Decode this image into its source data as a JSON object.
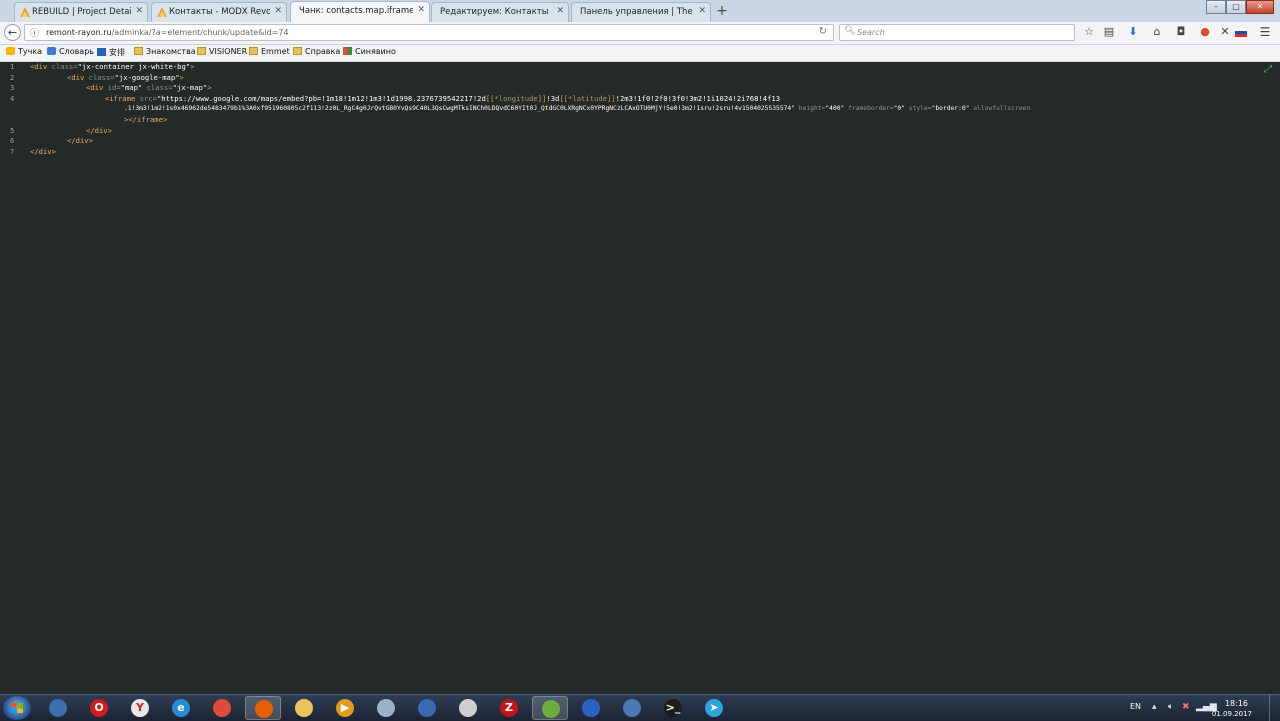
{
  "browser": {
    "tabs": [
      {
        "title": "REBUILD | Project Details",
        "icon": "modx-icon"
      },
      {
        "title": "Контакты - MODX Revolution",
        "icon": "modx-icon"
      },
      {
        "title": "Чанк: contacts.map.iframe | MOD",
        "icon": "none",
        "active": true
      },
      {
        "title": "Редактируем: Контакты | MODX",
        "icon": "none"
      },
      {
        "title": "Панель управления | The Pisicks",
        "icon": "none"
      }
    ],
    "new_tab_symbol": "+",
    "window_controls": {
      "minimize": "–",
      "maximize": "□",
      "close": "✕"
    },
    "url": {
      "host": "remont-rayon.ru",
      "path": "/adminka/?a=element/chunk/update&id=74"
    },
    "search_placeholder": "Search",
    "bookmarks": [
      {
        "label": "Тучка",
        "icon": "cloud-icon"
      },
      {
        "label": "Словарь",
        "icon": "dictionary-icon"
      },
      {
        "label": "安排",
        "icon": "calendar-icon"
      },
      {
        "label": "Знакомства",
        "icon": "folder-icon"
      },
      {
        "label": "VISIONER",
        "icon": "folder-icon"
      },
      {
        "label": "Emmet",
        "icon": "folder-icon"
      },
      {
        "label": "Справка",
        "icon": "folder-icon"
      },
      {
        "label": "Синявино",
        "icon": "grid-icon"
      }
    ]
  },
  "editor": {
    "line_numbers": [
      "1",
      "2",
      "3",
      "4",
      "5",
      "6",
      "7"
    ],
    "l1": {
      "open": "<div",
      "attr": " class=",
      "val": "\"jx-container jx-white-bg\"",
      "close": ">"
    },
    "l2": {
      "open": "<div",
      "attr": " class=",
      "val": "\"jx-google-map\"",
      "close": ">"
    },
    "l3": {
      "open": "<div",
      "attr1": " id=",
      "val1": "\"map\"",
      "attr2": " class=",
      "val2": "\"jx-map\"",
      "close": ">"
    },
    "l4a": {
      "open": "<iframe",
      "attr": " src=",
      "v1": "\"https://www.google.com/maps/embed?pb=!1m18!1m12!1m3!1d1998.2376739542217!2d",
      "b1": "[[",
      "p1": "*longitude",
      "b2": "]]",
      "v2": "!3d",
      "b3": "[[",
      "p2": "*latitude",
      "b4": "]]",
      "v3": "!2m3!1f0!2f0!3f0!3m2!1i1024!2i768!4f13"
    },
    "l4b": {
      "v": ".1!3m3!1m2!1s0x46962de5483479b1%3A0xf951960805c2f113!2z0L_RgC4g0JrQvtGB0YvQs9C40L3QsCwgMTksINCh0LDQvdC60YIt0J_QtdGC0LXRgNCx0YPRgNCzLCAxOTU0MjY!5e0!3m2!1sru!2sru!4v1504025535574\"",
      "a1": " height=",
      "av1": "\"400\"",
      "a2": " frameborder=",
      "av2": "\"0\"",
      "a3": " style=",
      "av3": "\"border:0\"",
      "a4": " allowfullscreen"
    },
    "l4c": {
      "close": "></iframe>"
    },
    "l5": "</div>",
    "l6": "</div>",
    "l7": "</div>"
  },
  "taskbar": {
    "apps": [
      {
        "name": "ie-globe-icon",
        "glyph": "",
        "color": "#3b6fb0"
      },
      {
        "name": "opera-icon",
        "glyph": "O",
        "color": "#d01c1c"
      },
      {
        "name": "yandex-icon",
        "glyph": "Y",
        "color": "#e8e8e8"
      },
      {
        "name": "internet-explorer-icon",
        "glyph": "e",
        "color": "#2a8ad4"
      },
      {
        "name": "chrome-icon",
        "glyph": "",
        "color": "#dd4b39"
      },
      {
        "name": "firefox-icon",
        "glyph": "",
        "color": "#e66000",
        "active": true
      },
      {
        "name": "explorer-folder-icon",
        "glyph": "",
        "color": "#e8c45a"
      },
      {
        "name": "media-player-icon",
        "glyph": "▶",
        "color": "#e39b1f"
      },
      {
        "name": "disc-icon",
        "glyph": "",
        "color": "#9bb2c8"
      },
      {
        "name": "network-icon",
        "glyph": "",
        "color": "#3a6bb2"
      },
      {
        "name": "github-icon",
        "glyph": "",
        "color": "#cfcfcf"
      },
      {
        "name": "filezilla-icon",
        "glyph": "Z",
        "color": "#c0161b"
      },
      {
        "name": "notepad-icon",
        "glyph": "",
        "color": "#6cae3c",
        "active": true
      },
      {
        "name": "calendar-app-icon",
        "glyph": "",
        "color": "#2b62c2"
      },
      {
        "name": "remote-desktop-icon",
        "glyph": "",
        "color": "#4b79b3"
      },
      {
        "name": "terminal-icon",
        "glyph": ">_",
        "color": "#1c1c1c"
      },
      {
        "name": "telegram-icon",
        "glyph": "➤",
        "color": "#2ea3dd"
      }
    ],
    "tray": {
      "lang": "EN",
      "time": "18:16",
      "date": "01.09.2017"
    }
  }
}
